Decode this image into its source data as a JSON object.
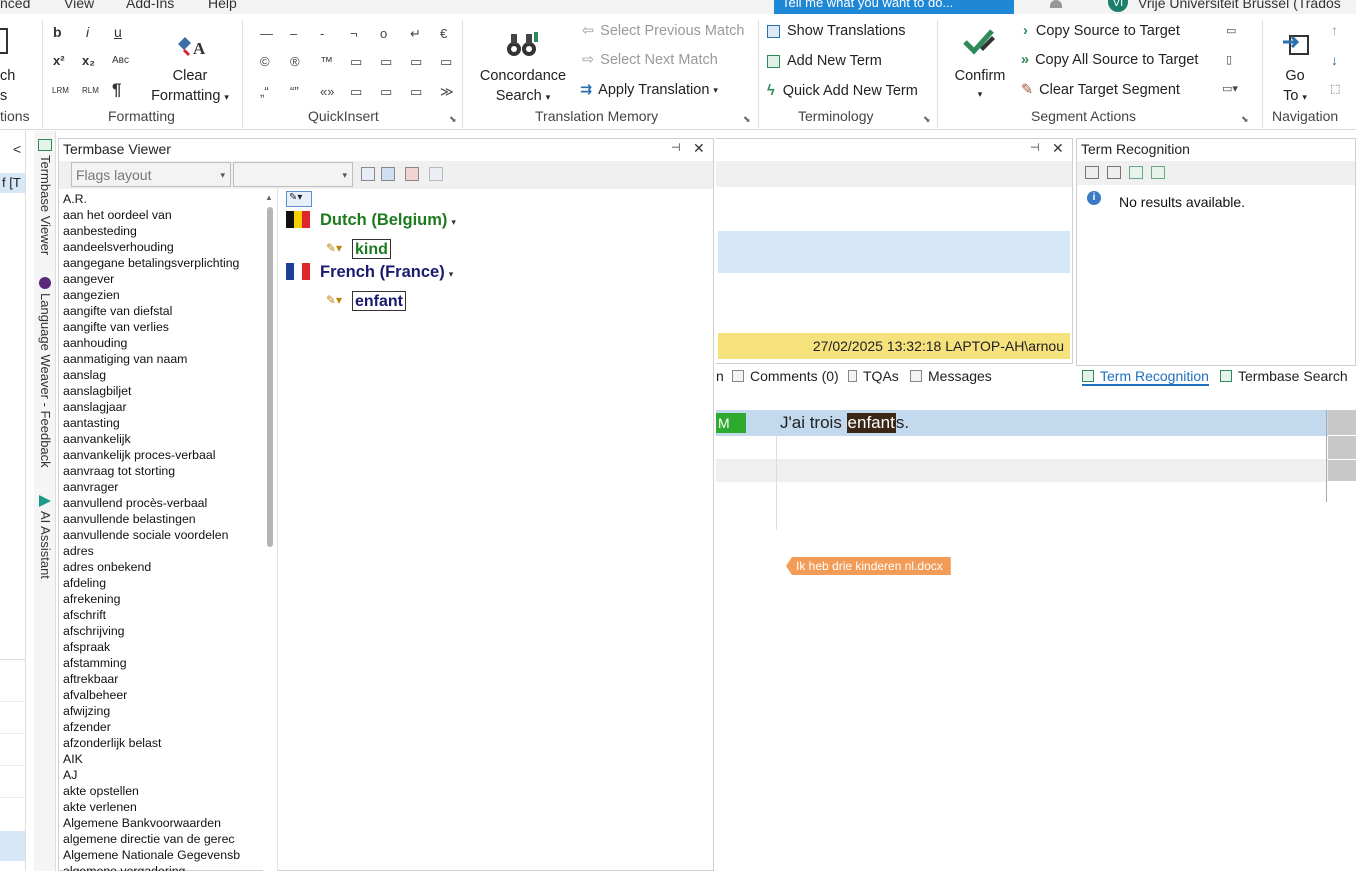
{
  "menu": {
    "items": [
      "nced",
      "View",
      "Add-Ins",
      "Help"
    ],
    "tell_me": "Tell me what you want to do...",
    "user_initials": "VI",
    "user_name": "Vrije Universiteit Brussel (Trados"
  },
  "ribbon": {
    "leftcut": {
      "line1": "ch",
      "line2": "s",
      "group": "tions"
    },
    "formatting": {
      "group": "Formatting",
      "bold": "b",
      "italic": "i",
      "underline": "u",
      "superscript": "x²",
      "subscript": "x₂",
      "smallcaps": "Aʙᴄ",
      "ltr": "LRM",
      "rtl": "RLM",
      "pilcrow": "¶",
      "clear_label1": "Clear",
      "clear_label2": "Formatting"
    },
    "quickinsert": {
      "group": "QuickInsert",
      "symbols": [
        "—",
        "–",
        "-",
        "¬",
        "o",
        "↵",
        "€",
        "©",
        "®",
        "™",
        "▭",
        "▭",
        "▭",
        "▭",
        "„“",
        "“”",
        "«»",
        "▭",
        "▭",
        "▭",
        "≫"
      ]
    },
    "tm": {
      "group": "Translation Memory",
      "concordance1": "Concordance",
      "concordance2": "Search",
      "prev_match": "Select Previous Match",
      "next_match": "Select Next Match",
      "apply_translation": "Apply Translation"
    },
    "terminology": {
      "group": "Terminology",
      "show_translations": "Show Translations",
      "add_new_term": "Add New Term",
      "quick_add": "Quick Add New Term"
    },
    "segment_actions": {
      "group": "Segment Actions",
      "confirm": "Confirm",
      "copy_source": "Copy Source to Target",
      "copy_all_source": "Copy All Source to Target",
      "clear_target": "Clear Target Segment"
    },
    "navigation": {
      "group": "Navigation",
      "goto1": "Go",
      "goto2": "To"
    }
  },
  "left": {
    "collapse": "<",
    "snippet": "f [T"
  },
  "vertical_tabs": [
    "Termbase Viewer",
    "Language Weaver - Feedback",
    "AI Assistant"
  ],
  "termbase_viewer": {
    "title": "Termbase Viewer",
    "layout_combo": "Flags layout",
    "second_combo": "",
    "terms": [
      "A.R.",
      "aan het oordeel van",
      "aanbesteding",
      "aandeelsverhouding",
      "aangegane betalingsverplichting",
      "aangever",
      "aangezien",
      "aangifte van diefstal",
      "aangifte van verlies",
      "aanhouding",
      "aanmatiging van naam",
      "aanslag",
      "aanslagbiljet",
      "aanslagjaar",
      "aantasting",
      "aanvankelijk",
      "aanvankelijk proces-verbaal",
      "aanvraag tot storting",
      "aanvrager",
      "aanvullend procès-verbaal",
      "aanvullende belastingen",
      "aanvullende sociale voordelen",
      "adres",
      "adres onbekend",
      "afdeling",
      "afrekening",
      "afschrift",
      "afschrijving",
      "afspraak",
      "afstamming",
      "aftrekbaar",
      "afvalbeheer",
      "afwijzing",
      "afzender",
      "afzonderlijk belast",
      "AIK",
      "AJ",
      "akte opstellen",
      "akte verlenen",
      "Algemene Bankvoorwaarden",
      "algemene directie van de gerec",
      "Algemene  Nationale Gegevensb",
      "algemene vergadering"
    ],
    "entry": {
      "lang1": "Dutch (Belgium)",
      "term1": "kind",
      "color1": "#1f7a1f",
      "lang2": "French (France)",
      "term2": "enfant",
      "color2": "#1a1a6e"
    }
  },
  "editor": {
    "status_bar": "27/02/2025 13:32:18  LAPTOP-AH\\arnou",
    "tabs": {
      "comments": "Comments (0)",
      "tqas": "TQAs",
      "messages": "Messages",
      "term_recognition": "Term Recognition",
      "termbase_search": "Termbase Search",
      "cut": "n"
    },
    "segment": {
      "match_tag": "M",
      "before": "J'ai trois ",
      "highlight": "enfant",
      "after": "s.",
      "file_tag": "Ik heb drie kinderen nl.docx"
    }
  },
  "term_recognition": {
    "title": "Term Recognition",
    "message": "No results available."
  }
}
